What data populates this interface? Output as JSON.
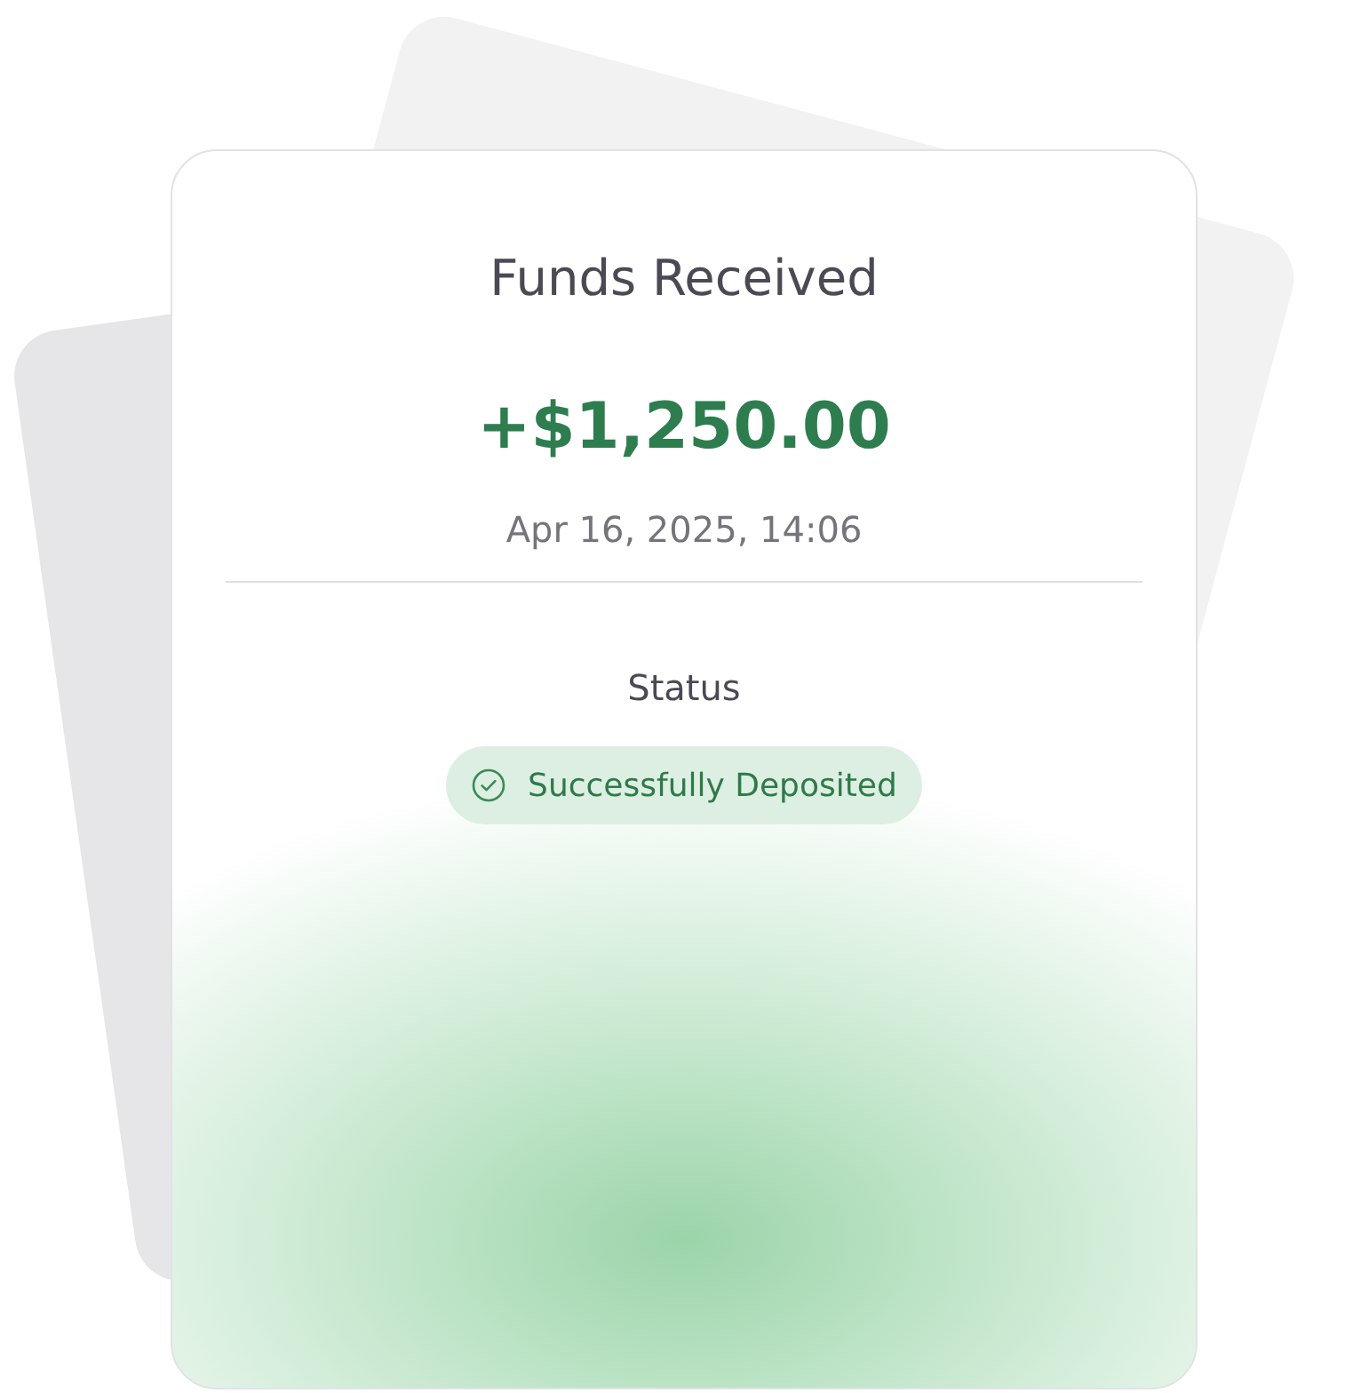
{
  "card": {
    "title": "Funds Received",
    "amount": "+$1,250.00",
    "timestamp": "Apr 16, 2025, 14:06",
    "status_label": "Status",
    "status": {
      "kind": "success",
      "text": "Successfully Deposited"
    }
  }
}
